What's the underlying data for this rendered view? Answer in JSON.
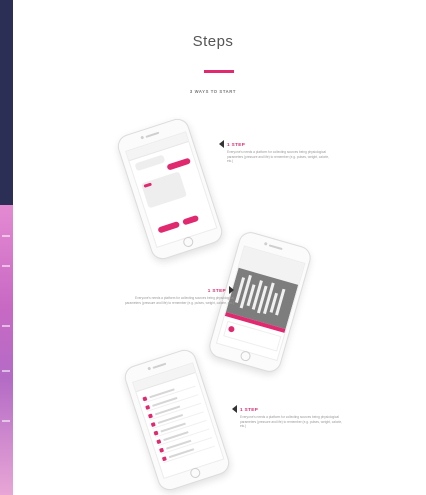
{
  "page": {
    "title": "Steps",
    "subtitle": "3 WAYS TO START",
    "accent_color": "#e0296f"
  },
  "steps": [
    {
      "label": "1 STEP",
      "description": "Everyone's needs a platform for collecting sources being physiological parameters (pressure and life) to remember (e.g. pulses, weight, calorie, etc.)"
    },
    {
      "label": "1 STEP",
      "description": "Everyone's needs a platform for collecting sources being physiological parameters (pressure and life) to remember (e.g. pulses, weight, calorie, etc.)"
    },
    {
      "label": "1 STEP",
      "description": "Everyone's needs a platform for collecting sources being physiological parameters (pressure and life) to remember (e.g. pulses, weight, calorie, etc.)"
    }
  ],
  "icons": {
    "step_arrow": "triangle-pointer-icon"
  }
}
